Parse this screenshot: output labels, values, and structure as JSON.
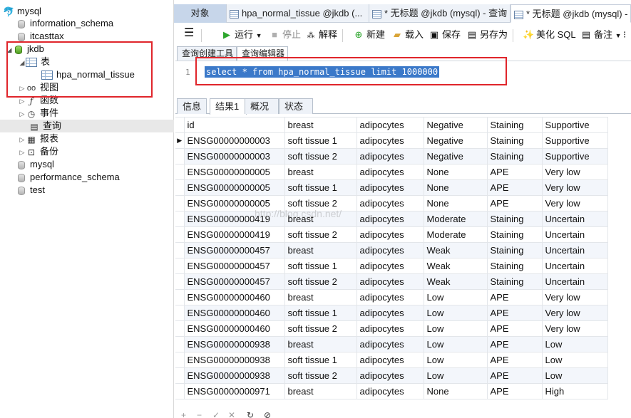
{
  "tree": {
    "items": [
      {
        "label": "mysql",
        "icon": "mysql-dolphin-icon"
      },
      {
        "label": "information_schema",
        "icon": "database-icon"
      },
      {
        "label": "itcasttax",
        "icon": "database-icon"
      },
      {
        "label": "jkdb",
        "icon": "database-open-icon"
      },
      {
        "label": "表",
        "icon": "table-folder-icon"
      },
      {
        "label": "hpa_normal_tissue",
        "icon": "table-icon"
      },
      {
        "label": "视图",
        "icon": "view-icon"
      },
      {
        "label": "函数",
        "icon": "function-icon"
      },
      {
        "label": "事件",
        "icon": "event-icon"
      },
      {
        "label": "查询",
        "icon": "query-icon"
      },
      {
        "label": "报表",
        "icon": "report-icon"
      },
      {
        "label": "备份",
        "icon": "backup-icon"
      },
      {
        "label": "mysql",
        "icon": "database-icon"
      },
      {
        "label": "performance_schema",
        "icon": "database-icon"
      },
      {
        "label": "test",
        "icon": "database-icon"
      }
    ]
  },
  "tabs": [
    {
      "label": "对象"
    },
    {
      "label": "hpa_normal_tissue @jkdb (..."
    },
    {
      "label": "* 无标题 @jkdb (mysql) - 查询"
    },
    {
      "label": "* 无标题 @jkdb (mysql) -"
    }
  ],
  "toolbar": {
    "menu_icon": "hamburger-menu-icon",
    "run": "运行",
    "stop": "停止",
    "explain": "解释",
    "new": "新建",
    "load": "载入",
    "save": "保存",
    "save_as": "另存为",
    "beautify": "美化 SQL",
    "comment": "备注"
  },
  "editor_tabs": [
    "查询创建工具",
    "查询编辑器"
  ],
  "editor": {
    "line_number": "1",
    "sql": "select * from hpa_normal_tissue limit 1000000"
  },
  "result_tabs": [
    "信息",
    "结果1",
    "概况",
    "状态"
  ],
  "grid": {
    "columns": [
      "id",
      "breast",
      "adipocytes",
      "Negative",
      "Staining",
      "Supportive"
    ],
    "rows": [
      [
        "ENSG00000000003",
        "soft tissue 1",
        "adipocytes",
        "Negative",
        "Staining",
        "Supportive"
      ],
      [
        "ENSG00000000003",
        "soft tissue 2",
        "adipocytes",
        "Negative",
        "Staining",
        "Supportive"
      ],
      [
        "ENSG00000000005",
        "breast",
        "adipocytes",
        "None",
        "APE",
        "Very low"
      ],
      [
        "ENSG00000000005",
        "soft tissue 1",
        "adipocytes",
        "None",
        "APE",
        "Very low"
      ],
      [
        "ENSG00000000005",
        "soft tissue 2",
        "adipocytes",
        "None",
        "APE",
        "Very low"
      ],
      [
        "ENSG00000000419",
        "breast",
        "adipocytes",
        "Moderate",
        "Staining",
        "Uncertain"
      ],
      [
        "ENSG00000000419",
        "soft tissue 2",
        "adipocytes",
        "Moderate",
        "Staining",
        "Uncertain"
      ],
      [
        "ENSG00000000457",
        "breast",
        "adipocytes",
        "Weak",
        "Staining",
        "Uncertain"
      ],
      [
        "ENSG00000000457",
        "soft tissue 1",
        "adipocytes",
        "Weak",
        "Staining",
        "Uncertain"
      ],
      [
        "ENSG00000000457",
        "soft tissue 2",
        "adipocytes",
        "Weak",
        "Staining",
        "Uncertain"
      ],
      [
        "ENSG00000000460",
        "breast",
        "adipocytes",
        "Low",
        "APE",
        "Very low"
      ],
      [
        "ENSG00000000460",
        "soft tissue 1",
        "adipocytes",
        "Low",
        "APE",
        "Very low"
      ],
      [
        "ENSG00000000460",
        "soft tissue 2",
        "adipocytes",
        "Low",
        "APE",
        "Very low"
      ],
      [
        "ENSG00000000938",
        "breast",
        "adipocytes",
        "Low",
        "APE",
        "Low"
      ],
      [
        "ENSG00000000938",
        "soft tissue 1",
        "adipocytes",
        "Low",
        "APE",
        "Low"
      ],
      [
        "ENSG00000000938",
        "soft tissue 2",
        "adipocytes",
        "Low",
        "APE",
        "Low"
      ],
      [
        "ENSG00000000971",
        "breast",
        "adipocytes",
        "None",
        "APE",
        "High"
      ]
    ]
  },
  "watermark": "http://blog.csdn.net/",
  "colors": {
    "highlight_box": "#e0252b",
    "selection": "#3b79c9",
    "run_green": "#2da62d"
  }
}
